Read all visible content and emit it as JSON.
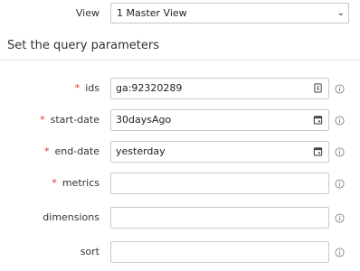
{
  "view": {
    "label": "View",
    "selected": "1 Master View"
  },
  "section": {
    "title": "Set the query parameters"
  },
  "fields": [
    {
      "label": "ids",
      "required": "*",
      "value": "ga:92320289"
    },
    {
      "label": "start-date",
      "required": "*",
      "value": "30daysAgo"
    },
    {
      "label": "end-date",
      "required": "*",
      "value": "yesterday"
    },
    {
      "label": "metrics",
      "required": "*",
      "value": ""
    },
    {
      "label": "dimensions",
      "required": "",
      "value": ""
    },
    {
      "label": "sort",
      "required": "",
      "value": ""
    }
  ],
  "icons": {
    "ids_field": "contact-card-icon",
    "date_fields": "calendar-icon",
    "help": "info-icon"
  }
}
